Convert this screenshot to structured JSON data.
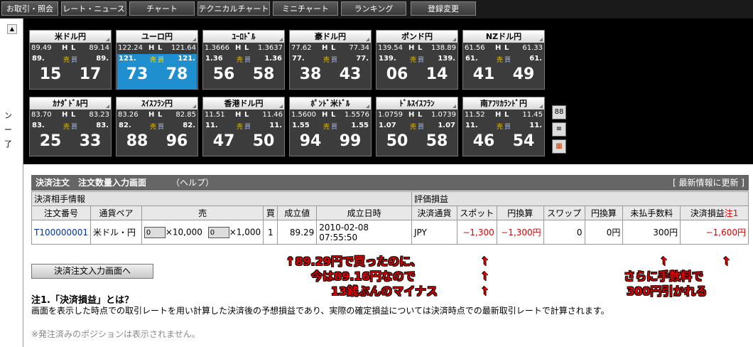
{
  "nav": [
    "お取引・照会",
    "レート・ニュース",
    "チャート",
    "テクニカルチャート",
    "ミニチャート",
    "ランキング",
    "登録変更"
  ],
  "side_glyphs": [
    "ン",
    "ー",
    "了"
  ],
  "tiles": [
    {
      "name": "米ドル円",
      "h": "89.49",
      "l": "89.14",
      "sp": "89.",
      "sb": "89.",
      "s": "15",
      "b": "17",
      "active": false
    },
    {
      "name": "ユーロ円",
      "h": "122.24",
      "l": "121.64",
      "sp": "121.",
      "sb": "121.",
      "s": "73",
      "b": "78",
      "active": true
    },
    {
      "name": "ﾕｰﾛﾄﾞﾙ",
      "h": "1.3666",
      "l": "1.3637",
      "sp": "1.36",
      "sb": "1.36",
      "s": "56",
      "b": "58",
      "active": false
    },
    {
      "name": "豪ドル円",
      "h": "77.62",
      "l": "77.34",
      "sp": "77.",
      "sb": "77.",
      "s": "38",
      "b": "43",
      "active": false
    },
    {
      "name": "ポンド円",
      "h": "139.54",
      "l": "138.89",
      "sp": "139.",
      "sb": "139.",
      "s": "06",
      "b": "14",
      "active": false
    },
    {
      "name": "NZドル円",
      "h": "61.56",
      "l": "61.33",
      "sp": "61.",
      "sb": "61.",
      "s": "41",
      "b": "49",
      "active": false
    },
    {
      "name": "ｶﾅﾀﾞﾄﾞﾙ円",
      "h": "83.70",
      "l": "83.23",
      "sp": "83.",
      "sb": "83.",
      "s": "25",
      "b": "33",
      "active": false
    },
    {
      "name": "ｽｲｽﾌﾗﾝ円",
      "h": "83.26",
      "l": "82.85",
      "sp": "82.",
      "sb": "82.",
      "s": "88",
      "b": "96",
      "active": false
    },
    {
      "name": "香港ドル円",
      "h": "11.51",
      "l": "11.46",
      "sp": "11.",
      "sb": "11.",
      "s": "47",
      "b": "50",
      "active": false
    },
    {
      "name": "ﾎﾟﾝﾄﾞ米ﾄﾞﾙ",
      "h": "1.5600",
      "l": "1.5576",
      "sp": "1.55",
      "sb": "1.55",
      "s": "94",
      "b": "99",
      "active": false
    },
    {
      "name": "ﾄﾞﾙｽｲｽﾌﾗﾝ",
      "h": "1.0759",
      "l": "1.0739",
      "sp": "1.07",
      "sb": "1.07",
      "s": "50",
      "b": "58",
      "active": false
    },
    {
      "name": "南ｱﾌﾘｶﾗﾝﾄﾞ円",
      "h": "11.52",
      "l": "11.45",
      "sp": "11.",
      "sb": "11.",
      "s": "46",
      "b": "54",
      "active": false
    }
  ],
  "labels": {
    "h": "H",
    "l": "L",
    "sell": "売",
    "buy": "買"
  },
  "side_buttons": [
    "88",
    "≡",
    "▦"
  ],
  "order": {
    "title": "決済注文　注文数量入力画面",
    "help": "（ヘルプ）",
    "refresh": "[ 最新情報に更新 ]",
    "sec_left": "決済相手情報",
    "sec_right": "評価損益",
    "headers": [
      "注文番号",
      "通貨ペア",
      "売",
      "買",
      "成立値",
      "成立日時",
      "決済通貨",
      "スポット",
      "円換算",
      "スワップ",
      "円換算",
      "未払手数料",
      "決済損益"
    ],
    "note_mark": "注1",
    "row": {
      "id": "T100000001",
      "pair": "米ドル・円",
      "q1": "0",
      "mult1": "×10,000",
      "q2": "0",
      "mult2": "×1,000",
      "buy": "1",
      "price": "89.29",
      "datetime": "2010-02-08 07:55:50",
      "currency": "JPY",
      "spot": "−1,300",
      "spot_yen": "−1,300円",
      "swap": "0",
      "swap_yen": "0円",
      "fee": "300円",
      "pl": "−1,600円"
    }
  },
  "entry_button": "決済注文入力画面へ",
  "note1_title": "注1.「決済損益」とは？",
  "note1_body": "画面を表示した時点での取引レートを用い計算した決済後の予想損益であり、実際の確定損益については決済時点での最新取引レートで計算されます。",
  "note2": "※発注済みのポジションは表示されません。",
  "annotations": {
    "a1": "↑89.29円で買ったのに、",
    "a2": "今は89.16円なので",
    "a3": "13銭ぶんのマイナス",
    "a4": "さらに手数料で",
    "a5": "300円引かれる",
    "arrow": "↑"
  }
}
